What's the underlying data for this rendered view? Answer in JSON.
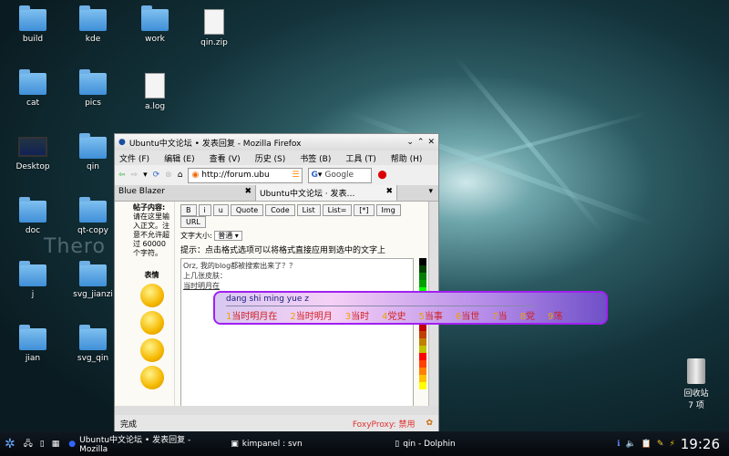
{
  "desktop": {
    "icons": [
      "build",
      "kde",
      "work",
      "qin.zip",
      "cat",
      "pics",
      "a.log",
      "Desktop",
      "qin",
      "doc",
      "qt-copy",
      "j",
      "svg_jianzi",
      "jian",
      "svg_qin"
    ],
    "watermark": "Thero",
    "trash": {
      "label": "回收站",
      "count": "7 项"
    }
  },
  "firefox": {
    "title": "Ubuntu中文论坛 • 发表回复 - Mozilla Firefox",
    "menu": [
      "文件 (F)",
      "编辑 (E)",
      "查看 (V)",
      "历史 (S)",
      "书签 (B)",
      "工具 (T)",
      "帮助 (H)"
    ],
    "url": "http://forum.ubu",
    "search_placeholder": "Google",
    "tabs": [
      "Blue Blazer",
      "Ubuntu中文论坛 · 发表…"
    ],
    "left": {
      "label": "帖子内容:",
      "hint": "请在这里输入正文。注意不允许超过 60000 个字符。",
      "emoticons": "表情"
    },
    "format_buttons": [
      "B",
      "i",
      "u",
      "Quote",
      "Code",
      "List",
      "List=",
      "[*]",
      "Img",
      "URL"
    ],
    "font_size_label": "文字大小:",
    "font_size_value": "普通",
    "tip": "提示：点击格式选项可以将格式直接应用到选中的文字上",
    "text_lines": [
      "Orz, 我的blog都被搜索出来了？？",
      "上几张皮肤："
    ],
    "composing": "当时明月在",
    "status": "完成",
    "foxyproxy": "FoxyProxy: 禁用"
  },
  "ime": {
    "pinyin": "dang shi ming yue z",
    "candidates": [
      [
        "1",
        "当时明月在"
      ],
      [
        "2",
        "当时明月"
      ],
      [
        "3",
        "当时"
      ],
      [
        "4",
        "党史"
      ],
      [
        "5",
        "当事"
      ],
      [
        "6",
        "当世"
      ],
      [
        "7",
        "当"
      ],
      [
        "8",
        "党"
      ],
      [
        "9",
        "荡"
      ]
    ]
  },
  "taskbar": {
    "tasks": [
      "Ubuntu中文论坛 • 发表回复 - Mozilla",
      "kimpanel : svn",
      "qin - Dolphin"
    ],
    "clock": "19:26"
  },
  "colors": {
    "ime_border": "#a020f0",
    "candidate": "#d02020",
    "index": "#f0a000"
  },
  "palette": [
    "#000000",
    "#004000",
    "#008000",
    "#00a000",
    "#00ff00",
    "#400000",
    "#404000",
    "#808000",
    "#80c000",
    "#c00000",
    "#c04000",
    "#c08000",
    "#c0c000",
    "#ff0000",
    "#ff4000",
    "#ff8000",
    "#ffc000",
    "#ffff00"
  ]
}
